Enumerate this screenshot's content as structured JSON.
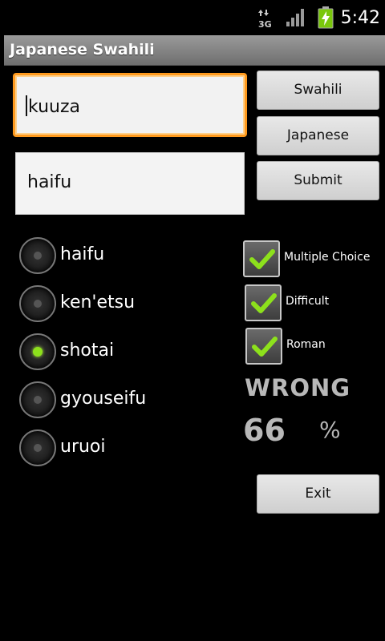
{
  "status_bar": {
    "time": "5:42",
    "network_label": "3G",
    "icons": [
      "data-transfer-3g-icon",
      "signal-strength-icon",
      "battery-charging-icon"
    ]
  },
  "title": "Japanese Swahili",
  "inputs": {
    "query": {
      "value": "kuuza",
      "focused": true
    },
    "answer": {
      "value": "haifu"
    }
  },
  "buttons": {
    "swahili": "Swahili",
    "japanese": "Japanese",
    "submit": "Submit",
    "exit": "Exit"
  },
  "choices": [
    {
      "label": "haifu",
      "checked": false
    },
    {
      "label": "ken'etsu",
      "checked": false
    },
    {
      "label": "shotai",
      "checked": true
    },
    {
      "label": "gyouseifu",
      "checked": false
    },
    {
      "label": "uruoi",
      "checked": false
    }
  ],
  "options": [
    {
      "label": "Multiple Choice",
      "checked": true
    },
    {
      "label": "Difficult",
      "checked": true
    },
    {
      "label": "Roman",
      "checked": true
    }
  ],
  "result": "WRONG",
  "score": "66",
  "percent_sign": "%",
  "colors": {
    "focus_border": "#ff9a1e",
    "check_green": "#8de11c",
    "title_bar": "#8a8a8a",
    "result_text": "#b8b8b8"
  }
}
